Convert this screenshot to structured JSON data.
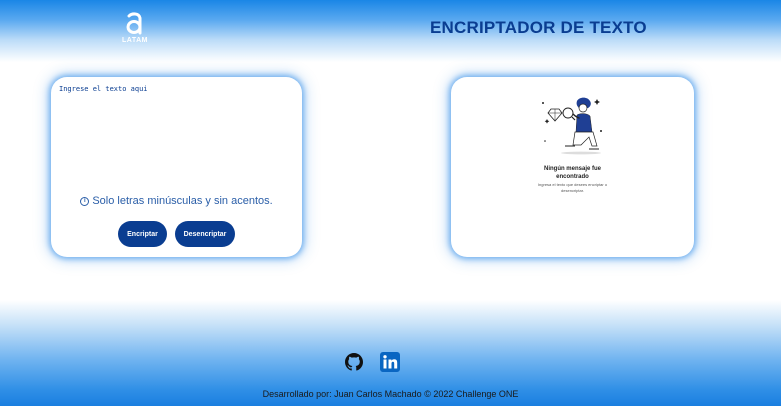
{
  "header": {
    "logo_text": "LATAM",
    "title": "ENCRIPTADOR DE TEXTO"
  },
  "input_card": {
    "placeholder": "Ingrese el texto aqui",
    "hint": "Solo letras minúsculas y sin acentos.",
    "info_glyph": "i",
    "encrypt_label": "Encriptar",
    "decrypt_label": "Desencriptar"
  },
  "output_card": {
    "empty_title": "Ningún mensaje fue encontrado",
    "empty_description": "Ingresa el texto que desees encriptar o desencriptar."
  },
  "footer": {
    "social": [
      "github-icon",
      "linkedin-icon"
    ],
    "credit": "Desarrollado por: Juan Carlos Machado © 2022 Challenge ONE"
  },
  "colors": {
    "primary": "#0a3d91",
    "accent_blue": "#1a86e6",
    "linkedin": "#0a66c2"
  }
}
